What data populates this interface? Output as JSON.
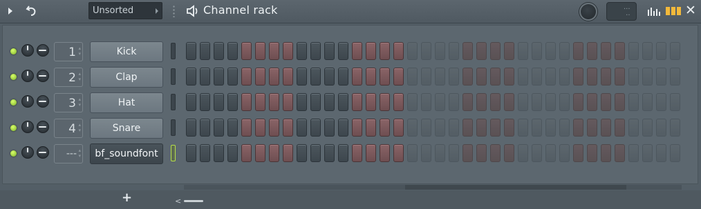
{
  "titlebar": {
    "title": "Channel rack",
    "preset": {
      "label": "Unsorted"
    },
    "icons": [
      "play-icon",
      "undo-icon",
      "speaker-icon",
      "swing-knob-icon",
      "graph-icon",
      "stepseq-icon",
      "close-icon"
    ],
    "close_glyph": "✕"
  },
  "channels": [
    {
      "route": "1",
      "name": "Kick",
      "selected": false
    },
    {
      "route": "2",
      "name": "Clap",
      "selected": false
    },
    {
      "route": "3",
      "name": "Hat",
      "selected": false
    },
    {
      "route": "4",
      "name": "Snare",
      "selected": false
    },
    {
      "route": "---",
      "name": "bf_soundfont",
      "selected": true
    }
  ],
  "steps": {
    "count": 36,
    "pattern_groups": 4,
    "visible_groups": [
      "g1",
      "g2",
      "g1",
      "g2",
      "g3",
      "g4",
      "g3",
      "g4",
      "g3"
    ]
  },
  "bottom": {
    "add_label": "+",
    "scroll_left": "<"
  },
  "colors": {
    "accent_led": "#b6e04a",
    "step_dark": "#4c565d",
    "step_red": "#8a6467"
  }
}
